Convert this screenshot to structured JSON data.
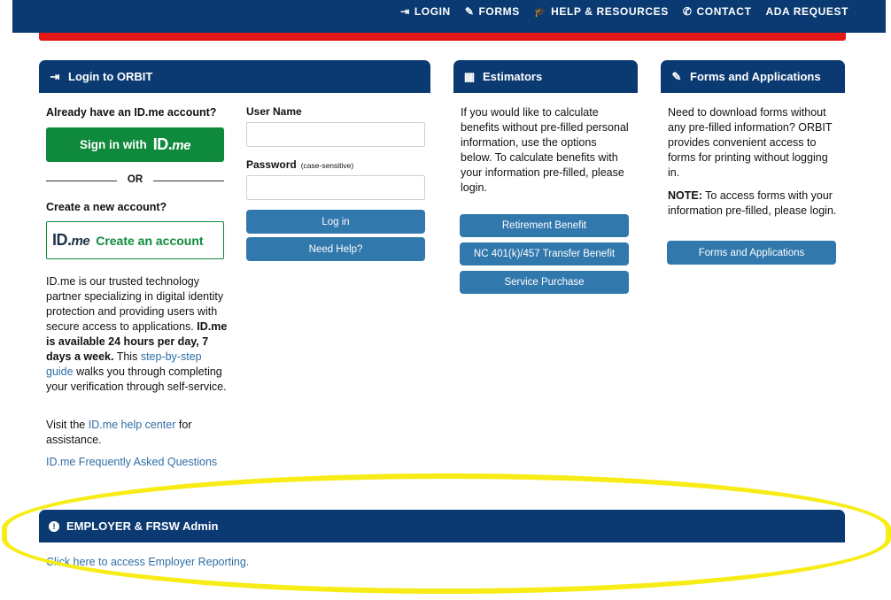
{
  "topnav": {
    "items": [
      {
        "icon": "sign-in-icon",
        "glyph": "⇥",
        "label": "LOGIN"
      },
      {
        "icon": "edit-icon",
        "glyph": "✎",
        "label": "FORMS"
      },
      {
        "icon": "graduation-cap-icon",
        "glyph": "🎓",
        "label": "HELP & RESOURCES"
      },
      {
        "icon": "phone-icon",
        "glyph": "✆",
        "label": "CONTACT"
      },
      {
        "icon": "",
        "glyph": "",
        "label": "ADA REQUEST"
      }
    ]
  },
  "login_panel": {
    "title": "Login to ORBIT",
    "icon": "sign-in-icon",
    "have_account": "Already have an ID.me account?",
    "sign_in_label": "Sign in with",
    "idme_mark_id": "ID.",
    "idme_mark_me": "me",
    "or_text": "OR",
    "create_heading": "Create a new account?",
    "create_label": "Create an account",
    "desc_1": "ID.me is our trusted technology partner specializing in digital identity protection and providing users with secure access to applications.",
    "desc_bold": "ID.me is available 24 hours per day, 7 days a week.",
    "desc_2": "This",
    "desc_link": "step-by-step guide",
    "desc_3": "walks you through completing your verification through self-service.",
    "visit_1": "Visit the",
    "visit_link": "ID.me help center",
    "visit_2": "for assistance.",
    "faq_link": "ID.me Frequently Asked Questions",
    "username_label": "User Name",
    "username_value": "",
    "password_label": "Password",
    "password_hint": "(case-sensitive)",
    "password_value": "",
    "login_button": "Log in",
    "help_button": "Need Help?"
  },
  "estimators_panel": {
    "title": "Estimators",
    "icon": "calculator-icon",
    "body": "If you would like to calculate benefits without pre-filled personal information, use the options below. To calculate benefits with your information pre-filled, please login.",
    "buttons": [
      "Retirement Benefit",
      "NC 401(k)/457 Transfer Benefit",
      "Service Purchase"
    ]
  },
  "forms_panel": {
    "title": "Forms and Applications",
    "icon": "edit-icon",
    "body": "Need to download forms without any pre-filled information? ORBIT provides convenient access to forms for printing without logging in.",
    "note_label": "NOTE:",
    "note_text": "To access forms with your information pre-filled, please login.",
    "button": "Forms and Applications"
  },
  "employer_panel": {
    "title": "EMPLOYER & FRSW Admin",
    "icon": "exclamation-circle-icon",
    "link": "Click here to access Employer Reporting."
  },
  "colors": {
    "navy": "#0b3a72",
    "red_bar": "#e51616",
    "green": "#0f8a3c",
    "button_blue": "#3178ad",
    "link_blue": "#2f6ea5",
    "highlight_yellow": "#f7ec15"
  }
}
